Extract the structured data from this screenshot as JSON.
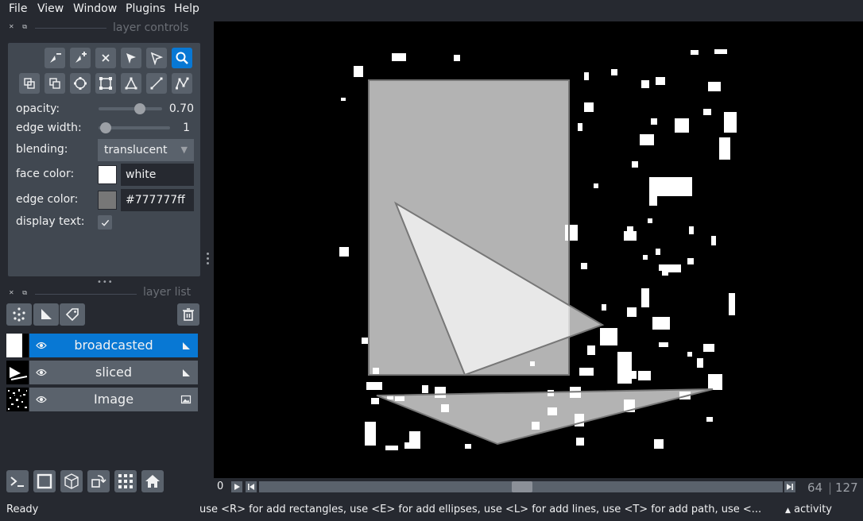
{
  "menu": [
    "File",
    "View",
    "Window",
    "Plugins",
    "Help"
  ],
  "layer_controls": {
    "title": "layer controls",
    "opacity": {
      "label": "opacity:",
      "value": "0.70"
    },
    "edge_width": {
      "label": "edge width:",
      "value": "1"
    },
    "blending": {
      "label": "blending:",
      "value": "translucent"
    },
    "face_color": {
      "label": "face color:",
      "value": "white",
      "swatch": "#ffffff"
    },
    "edge_color": {
      "label": "edge color:",
      "value": "#777777ff",
      "swatch": "#777777"
    },
    "display_text": {
      "label": "display text:",
      "checked": true
    }
  },
  "layer_list": {
    "title": "layer list",
    "layers": [
      {
        "name": "broadcasted",
        "selected": true,
        "type": "shapes"
      },
      {
        "name": "sliced",
        "selected": false,
        "type": "shapes"
      },
      {
        "name": "Image",
        "selected": false,
        "type": "image"
      }
    ]
  },
  "dims": {
    "index": "0",
    "current": "64",
    "total": "127"
  },
  "status": {
    "ready": "Ready",
    "help": "use <R> for add rectangles, use <E> for add ellipses, use <L> for add lines, use <T> for add path, use <...",
    "activity": "activity"
  },
  "colors": {
    "accent": "#0878d4",
    "panel": "#414851",
    "button": "#5a626c",
    "background": "#262930"
  }
}
